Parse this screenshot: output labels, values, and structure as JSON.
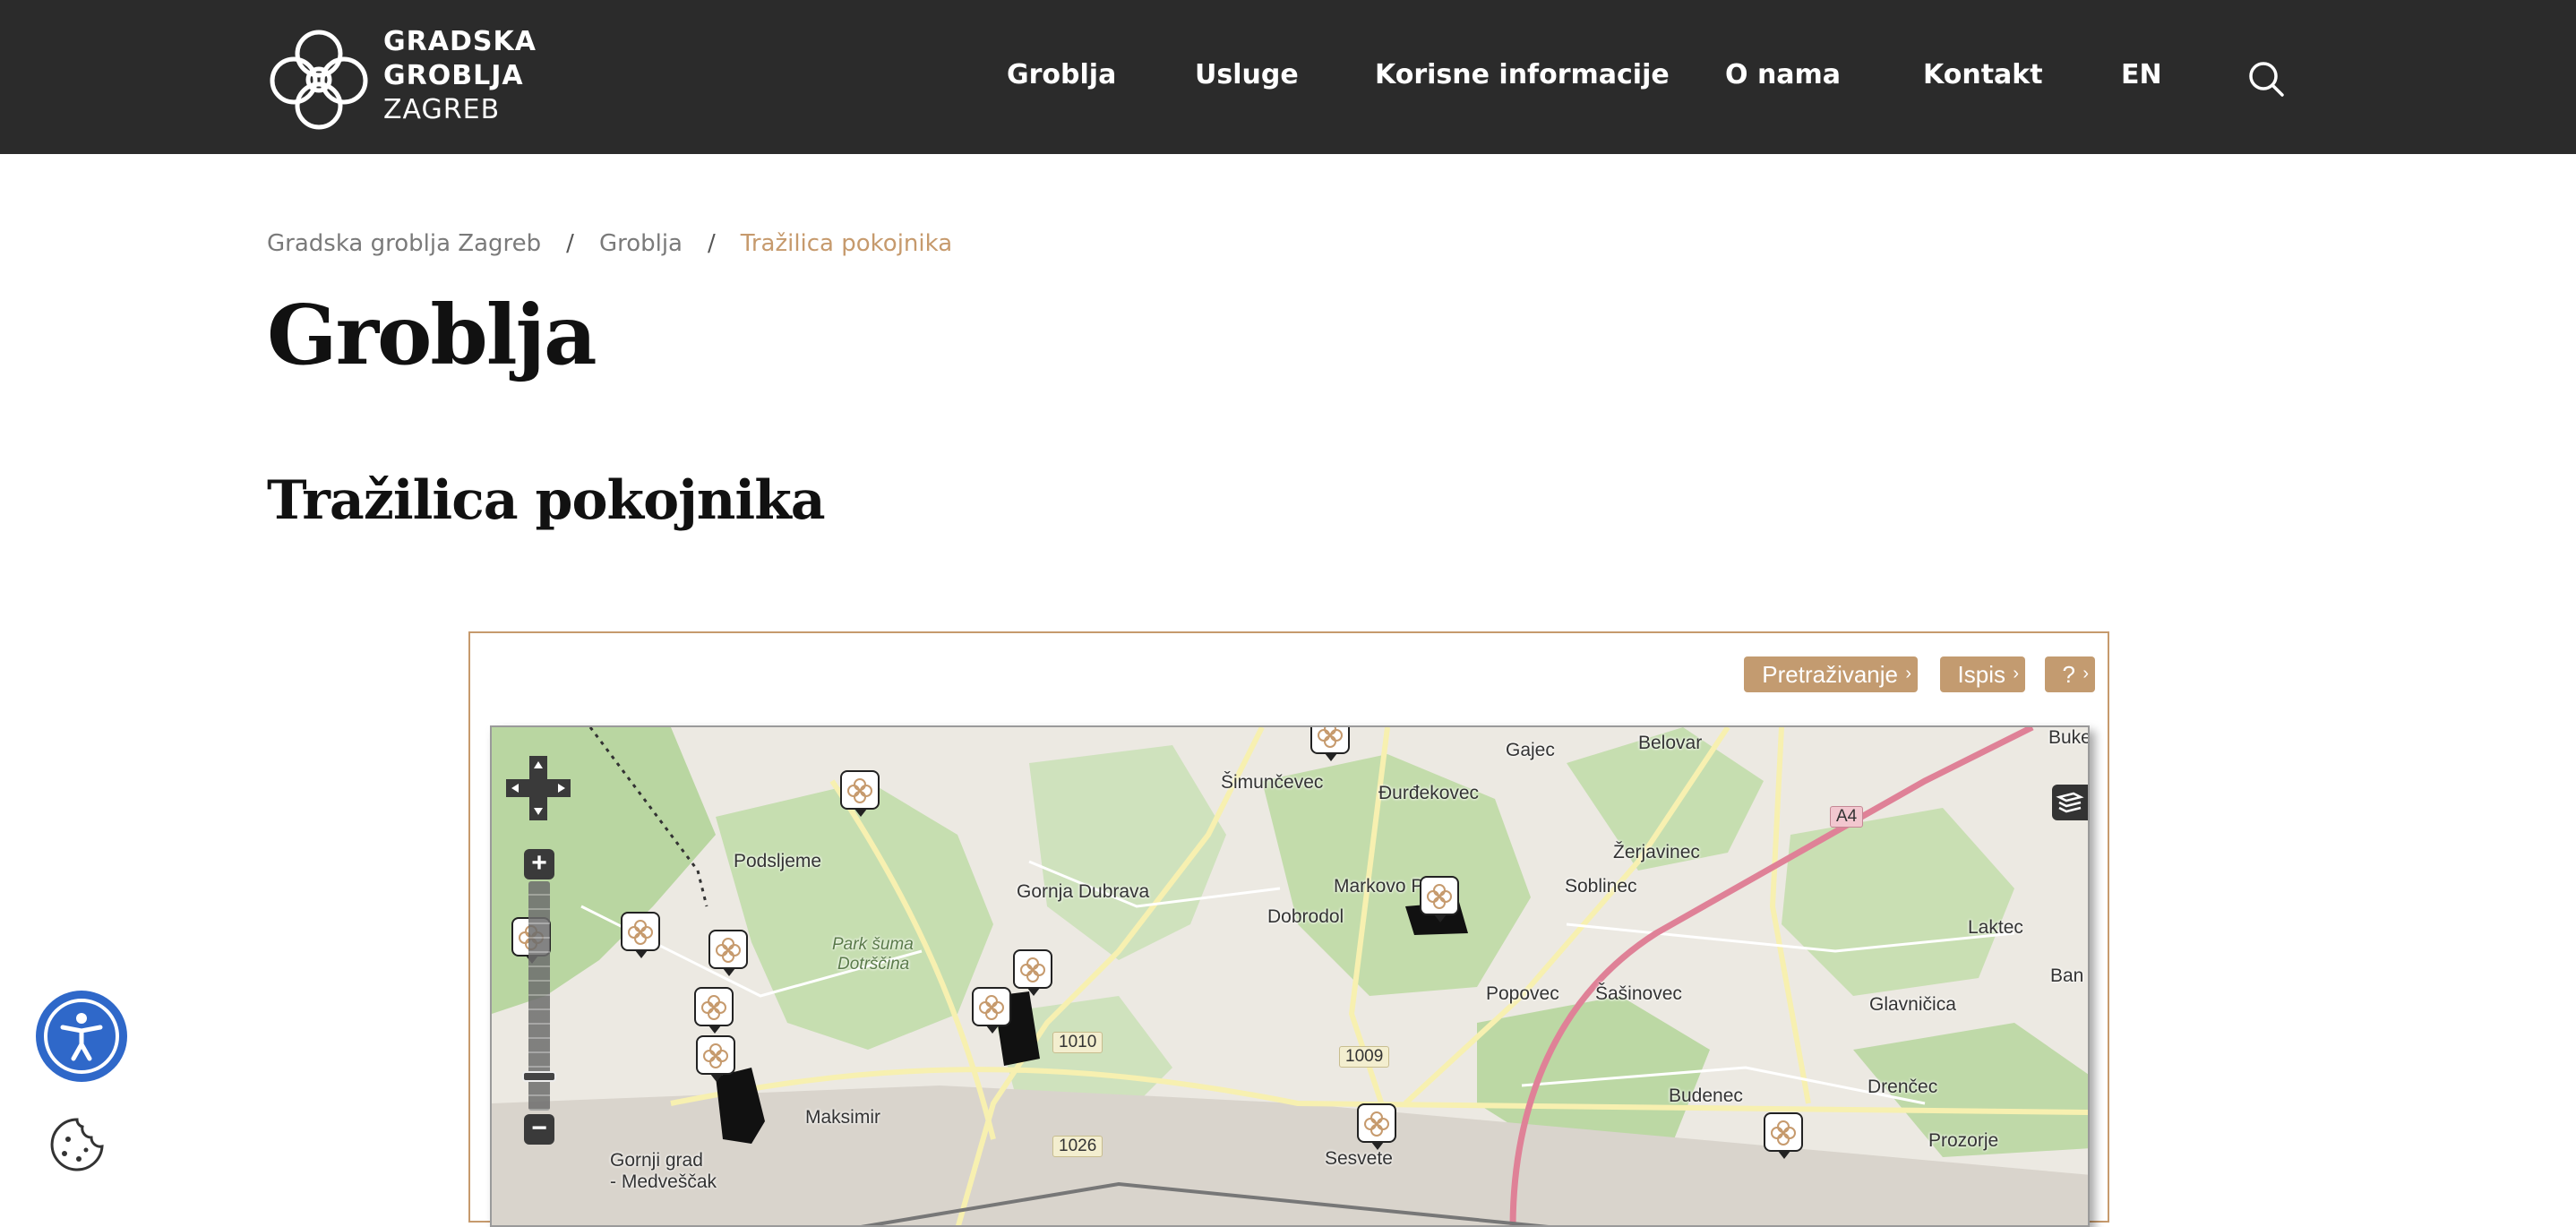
{
  "brand": {
    "line1": "GRADSKA",
    "line2": "GROBLJA",
    "line3": "ZAGREB"
  },
  "nav": {
    "items": [
      {
        "label": "Groblja"
      },
      {
        "label": "Usluge"
      },
      {
        "label": "Korisne informacije"
      },
      {
        "label": "O nama"
      },
      {
        "label": "Kontakt"
      },
      {
        "label": "EN"
      }
    ],
    "search_icon": "search-icon"
  },
  "breadcrumb": {
    "items": [
      "Gradska groblja Zagreb",
      "Groblja",
      "Tražilica pokojnika"
    ],
    "separator": "/"
  },
  "page": {
    "title": "Groblja",
    "section_title": "Tražilica pokojnika"
  },
  "map_widget": {
    "toolbar": {
      "search_label": "Pretraživanje",
      "print_label": "Ispis",
      "help_label": "?",
      "arrow": "›"
    },
    "controls": {
      "zoom_in": "+",
      "zoom_out": "−"
    },
    "places": [
      "Šimunčevec",
      "Gajec",
      "Belovar",
      "Đurđekovec",
      "Podsljeme",
      "Gornja Dubrava",
      "Markovo P",
      "Žerjavinec",
      "Dobrodol",
      "Soblinec",
      "Laktec",
      "Park šuma",
      "Dotrščina",
      "Popovec",
      "Šašinovec",
      "Glavničica",
      "Ban",
      "Budenec",
      "Drenčec",
      "Maksimir",
      "Prozorje",
      "Gornji grad",
      "- Medveščak",
      "Sesvete",
      "Buke"
    ],
    "road_labels": [
      "A4",
      "1010",
      "1009",
      "1026"
    ]
  },
  "floating": {
    "accessibility_icon": "accessibility-icon",
    "cookie_icon": "cookie-icon"
  },
  "colors": {
    "header_bg": "#2b2b2b",
    "accent": "#c69a6d",
    "button_bg": "#c39b70",
    "a11y_blue": "#2f68c9"
  }
}
